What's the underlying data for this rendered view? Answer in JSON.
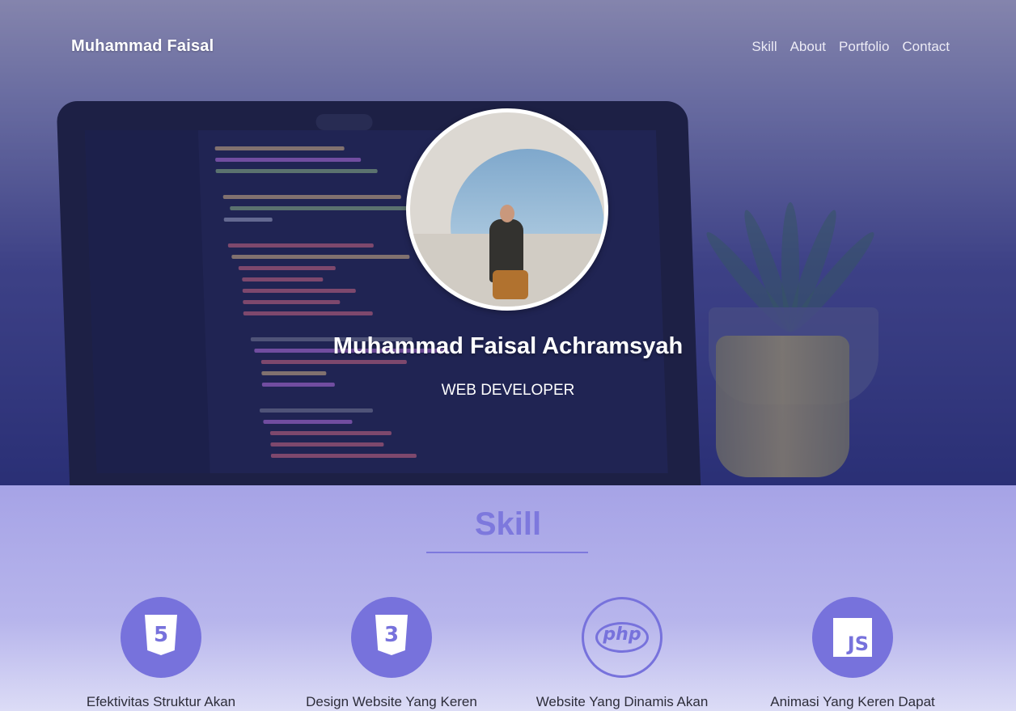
{
  "nav": {
    "brand": "Muhammad Faisal",
    "links": [
      "Skill",
      "About",
      "Portfolio",
      "Contact"
    ]
  },
  "hero": {
    "name": "Muhammad Faisal Achramsyah",
    "role": "WEB DEVELOPER"
  },
  "skill": {
    "title": "Skill",
    "items": [
      {
        "icon": "html5-icon",
        "icon_text": "5",
        "caption": "Efektivitas Struktur Akan"
      },
      {
        "icon": "css3-icon",
        "icon_text": "3",
        "caption": "Design Website Yang Keren"
      },
      {
        "icon": "php-icon",
        "icon_text": "php",
        "caption": "Website Yang Dinamis Akan"
      },
      {
        "icon": "javascript-icon",
        "icon_text": "JS",
        "caption": "Animasi Yang Keren Dapat"
      }
    ]
  },
  "colors": {
    "accent": "#7772dc",
    "skill_bg": "#a6a3e6",
    "hero_overlay": "#2f3475"
  }
}
